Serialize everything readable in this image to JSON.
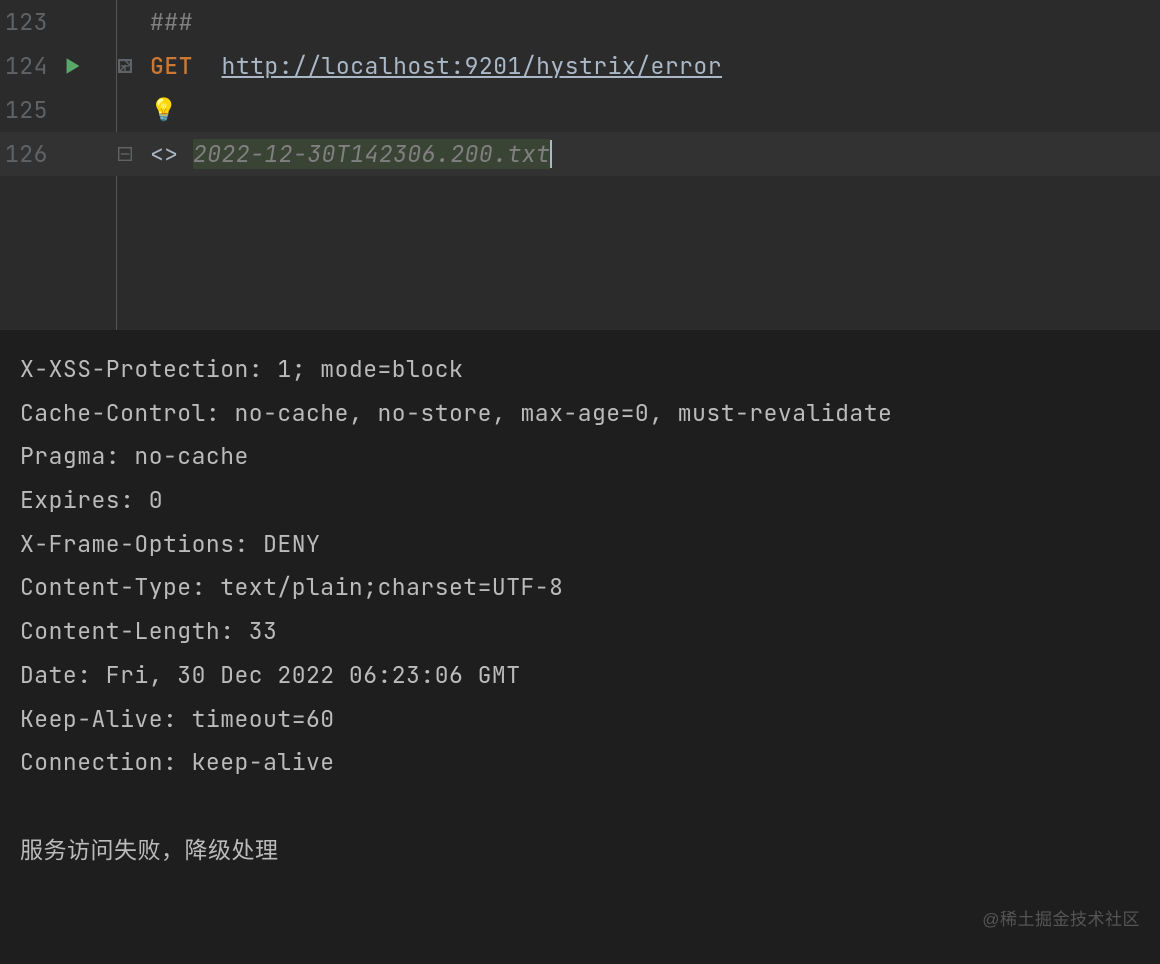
{
  "editor": {
    "lines": [
      {
        "num": "123",
        "comment": "###"
      },
      {
        "num": "124",
        "method": "GET",
        "url": "http://localhost:9201/hystrix/error"
      },
      {
        "num": "125"
      },
      {
        "num": "126",
        "tag": "<>",
        "file": "2022-12-30T142306.200.txt"
      }
    ]
  },
  "response": {
    "headers": [
      "X-XSS-Protection: 1; mode=block",
      "Cache-Control: no-cache, no-store, max-age=0, must-revalidate",
      "Pragma: no-cache",
      "Expires: 0",
      "X-Frame-Options: DENY",
      "Content-Type: text/plain;charset=UTF-8",
      "Content-Length: 33",
      "Date: Fri, 30 Dec 2022 06:23:06 GMT",
      "Keep-Alive: timeout=60",
      "Connection: keep-alive"
    ],
    "body": "服务访问失败，降级处理"
  },
  "watermark": "@稀土掘金技术社区"
}
